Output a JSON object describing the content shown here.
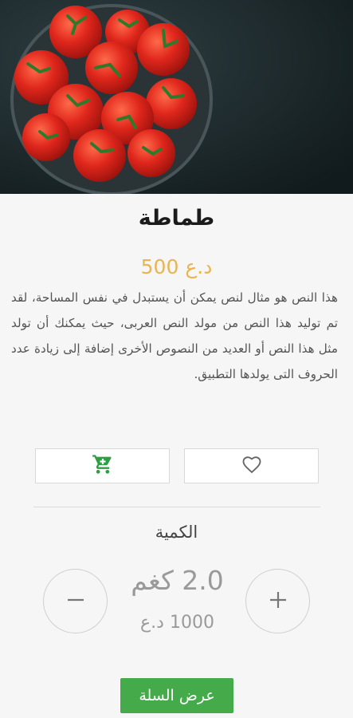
{
  "product": {
    "image_alt": "tomatoes-photo",
    "name": "طماطة",
    "price": "500 د.ع",
    "description": "هذا النص هو مثال لنص يمكن أن يستبدل في نفس المساحة، لقد تم توليد هذا النص من مولد النص العربى، حيث يمكنك أن تولد مثل هذا النص أو العديد من النصوص الأخرى إضافة إلى زيادة عدد الحروف التى يولدها التطبيق."
  },
  "actions": {
    "add_to_cart_icon": "cart-icon",
    "favorite_icon": "heart-icon"
  },
  "quantity": {
    "label": "الكمية",
    "value": "2.0 كغم",
    "total": "1000 د.ع",
    "minus_icon": "minus-icon",
    "plus_icon": "plus-icon"
  },
  "footer": {
    "view_cart_label": "عرض السلة"
  },
  "colors": {
    "price": "#e9b451",
    "accent_green": "#44aa4a",
    "cart_icon": "#2e9e45"
  }
}
